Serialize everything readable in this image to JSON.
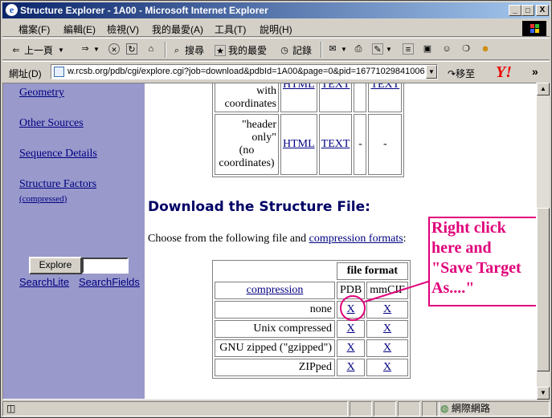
{
  "window": {
    "title": "Structure Explorer - 1A00 - Microsoft Internet Explorer",
    "minimize": "_",
    "maximize": "□",
    "close": "X"
  },
  "menu": [
    "檔案(F)",
    "編輯(E)",
    "檢視(V)",
    "我的最愛(A)",
    "工具(T)",
    "說明(H)"
  ],
  "toolbar": {
    "back_label": "上一頁",
    "search_label": "搜尋",
    "favorites_label": "我的最愛",
    "history_label": "記錄"
  },
  "address": {
    "label": "網址(D)",
    "url": "w.rcsb.org/pdb/cgi/explore.cgi?job=download&pdbId=1A00&page=0&pid=16771029841006",
    "go_label": "移至",
    "more": "»"
  },
  "sidebar": {
    "links": [
      "Geometry",
      "Other Sources",
      "Sequence Details",
      "Structure Factors"
    ],
    "compressed_label": "(compressed)",
    "explore_button": "Explore",
    "search_lite": "SearchLite",
    "search_fields": "SearchFields"
  },
  "top_table": {
    "row1": {
      "label_line1": "with",
      "label_line2": "coordinates",
      "html": "HTML",
      "text": "TEXT",
      "dash": "",
      "text2": "TEXT"
    },
    "row2": {
      "label_lines": [
        "\"header",
        "only\"",
        "(no",
        "coordinates)"
      ],
      "html": "HTML",
      "text": "TEXT",
      "dash1": "-",
      "dash2": "-"
    }
  },
  "download": {
    "heading": "Download the Structure File:",
    "choose_text": "Choose from the following file and ",
    "formats_link": "compression formats",
    "colon": ":",
    "table": {
      "file_format": "file format",
      "compression": "compression",
      "pdb": "PDB",
      "mmcif": "mmCIF",
      "rows": [
        {
          "label": "none",
          "pdb": "X",
          "mmcif": "X"
        },
        {
          "label": "Unix compressed",
          "pdb": "X",
          "mmcif": "X"
        },
        {
          "label": "GNU zipped (\"gzipped\")",
          "pdb": "X",
          "mmcif": "X"
        },
        {
          "label": "ZIPped",
          "pdb": "X",
          "mmcif": "X"
        }
      ]
    }
  },
  "callout": {
    "lines": [
      "Right click",
      "here and",
      "\"Save Target",
      "As....\""
    ],
    "color": "#e0007a"
  },
  "status": {
    "zone": "網際網路"
  }
}
